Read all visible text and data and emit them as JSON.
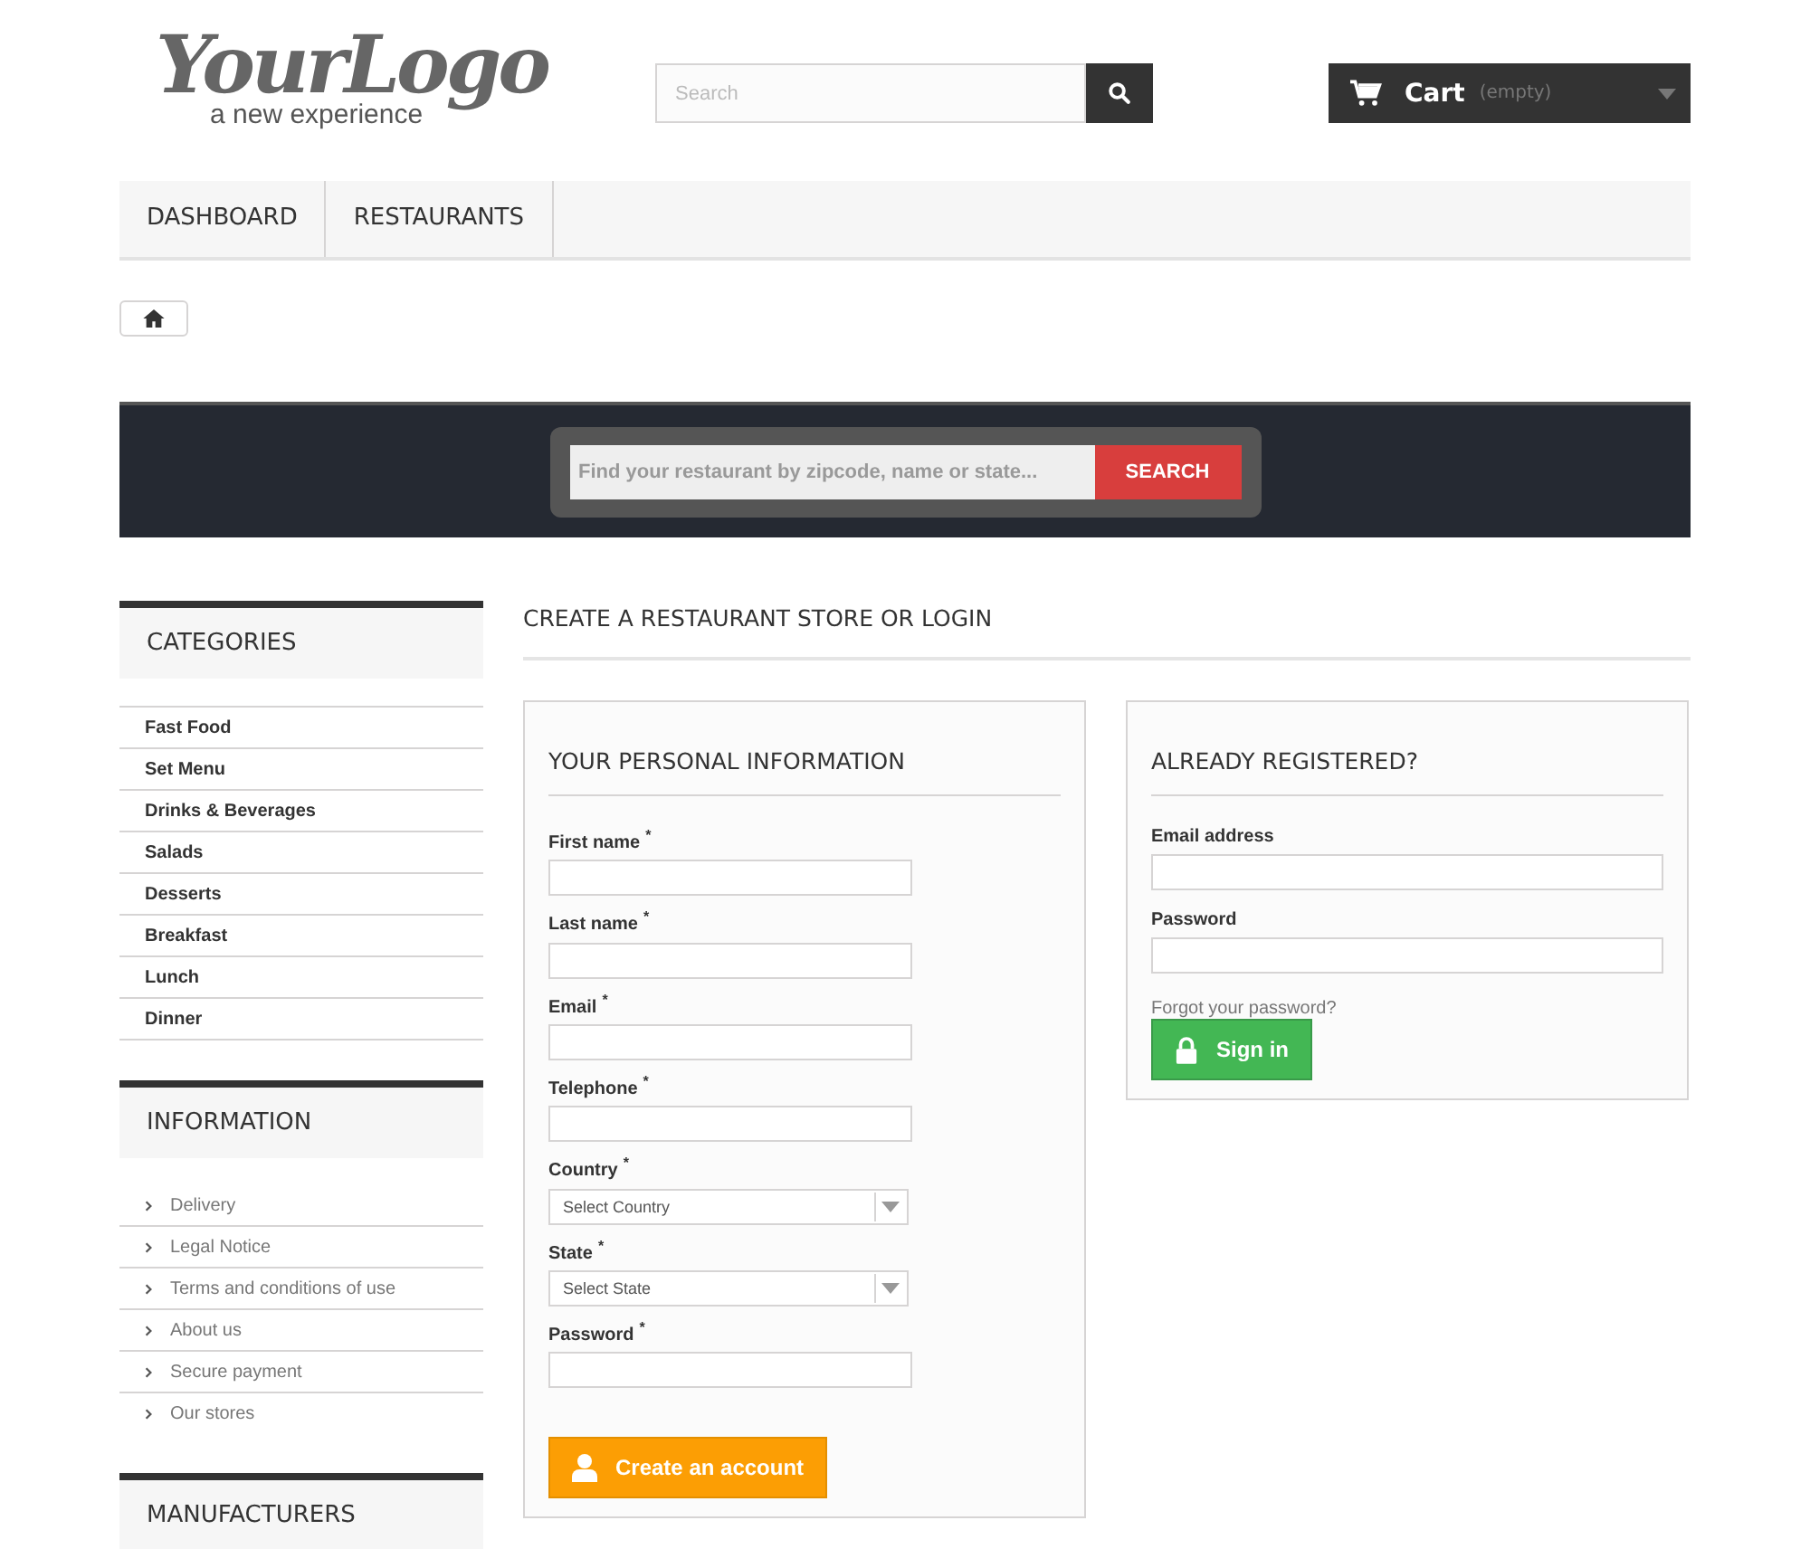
{
  "logo": {
    "title": "YourLogo",
    "tagline": "a new experience"
  },
  "header_search": {
    "placeholder": "Search"
  },
  "cart": {
    "label": "Cart",
    "status": "(empty)"
  },
  "nav": [
    {
      "label": "DASHBOARD"
    },
    {
      "label": "RESTAURANTS"
    }
  ],
  "restaurant_search": {
    "placeholder": "Find your restaurant by zipcode, name or state...",
    "button": "SEARCH"
  },
  "sidebar": [
    {
      "kind": "plain",
      "title": "CATEGORIES",
      "items": [
        "Fast Food",
        "Set Menu",
        "Drinks & Beverages",
        "Salads",
        "Desserts",
        "Breakfast",
        "Lunch",
        "Dinner"
      ]
    },
    {
      "kind": "chevron",
      "title": "INFORMATION",
      "items": [
        "Delivery",
        "Legal Notice",
        "Terms and conditions of use",
        "About us",
        "Secure payment",
        "Our stores"
      ]
    },
    {
      "title": "MANUFACTURERS"
    }
  ],
  "page_title": "CREATE A RESTAURANT STORE OR LOGIN",
  "create_form": {
    "title": "YOUR PERSONAL INFORMATION",
    "fields": [
      {
        "kind": "text",
        "label": "First name",
        "required_mark": "*"
      },
      {
        "kind": "text",
        "label": "Last name",
        "required_mark": "*"
      },
      {
        "kind": "text",
        "label": "Email",
        "required_mark": "*"
      },
      {
        "kind": "text",
        "label": "Telephone",
        "required_mark": "*"
      },
      {
        "kind": "select",
        "label": "Country",
        "required_mark": "*",
        "value": "Select Country"
      },
      {
        "kind": "select",
        "label": "State",
        "required_mark": "*",
        "value": "Select State"
      },
      {
        "kind": "text",
        "label": "Password",
        "required_mark": "*"
      }
    ],
    "button": "Create an account"
  },
  "login_form": {
    "title": "ALREADY REGISTERED?",
    "fields": [
      {
        "kind": "text",
        "label": "Email address"
      },
      {
        "kind": "text",
        "label": "Password"
      }
    ],
    "forgot_link": "Forgot your password?",
    "button": "Sign in"
  }
}
